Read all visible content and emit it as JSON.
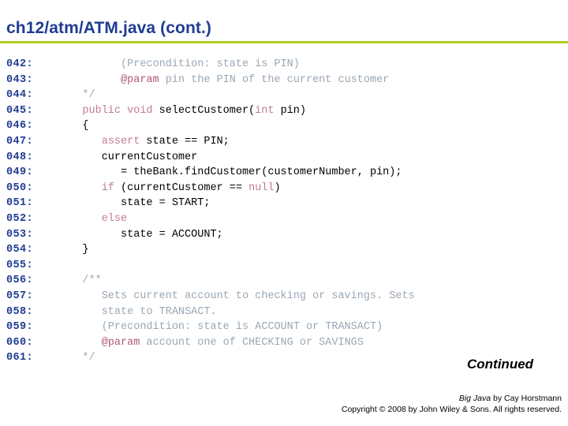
{
  "slide": {
    "title": "ch12/atm/ATM.java  (cont.)",
    "rule_color": "#b0ce22",
    "title_color": "#1f3c94"
  },
  "continued_label": "Continued",
  "footer": {
    "credit_book": "Big Java",
    "credit_rest": " by  Cay Horstmann",
    "copyright": "Copyright © 2008 by John Wiley  & Sons.  All rights reserved."
  },
  "colors": {
    "keyword": "#c07d92",
    "comment": "#9aa7b4",
    "javadoc_tag": "#b05878",
    "plain": "#000000",
    "lineno": "#1f3c94"
  },
  "code": {
    "lines": [
      {
        "no": "042:",
        "tokens": [
          {
            "t": "          (Precondition: state is PIN)",
            "c": "comment"
          }
        ]
      },
      {
        "no": "043:",
        "tokens": [
          {
            "t": "          ",
            "c": "plain"
          },
          {
            "t": "@param",
            "c": "tag"
          },
          {
            "t": " pin the PIN of the current customer",
            "c": "comment"
          }
        ]
      },
      {
        "no": "044:",
        "tokens": [
          {
            "t": "    */",
            "c": "comment"
          }
        ]
      },
      {
        "no": "045:",
        "tokens": [
          {
            "t": "    ",
            "c": "plain"
          },
          {
            "t": "public void",
            "c": "keyword"
          },
          {
            "t": " selectCustomer(",
            "c": "plain"
          },
          {
            "t": "int",
            "c": "keyword"
          },
          {
            "t": " pin)",
            "c": "plain"
          }
        ]
      },
      {
        "no": "046:",
        "tokens": [
          {
            "t": "    {",
            "c": "plain"
          }
        ]
      },
      {
        "no": "047:",
        "tokens": [
          {
            "t": "       ",
            "c": "plain"
          },
          {
            "t": "assert",
            "c": "keyword"
          },
          {
            "t": " state == PIN;",
            "c": "plain"
          }
        ]
      },
      {
        "no": "048:",
        "tokens": [
          {
            "t": "       currentCustomer",
            "c": "plain"
          }
        ]
      },
      {
        "no": "049:",
        "tokens": [
          {
            "t": "          = theBank.findCustomer(customerNumber, pin);",
            "c": "plain"
          }
        ]
      },
      {
        "no": "050:",
        "tokens": [
          {
            "t": "       ",
            "c": "plain"
          },
          {
            "t": "if",
            "c": "keyword"
          },
          {
            "t": " (currentCustomer == ",
            "c": "plain"
          },
          {
            "t": "null",
            "c": "keyword"
          },
          {
            "t": ")",
            "c": "plain"
          }
        ]
      },
      {
        "no": "051:",
        "tokens": [
          {
            "t": "          state = START;",
            "c": "plain"
          }
        ]
      },
      {
        "no": "052:",
        "tokens": [
          {
            "t": "       ",
            "c": "plain"
          },
          {
            "t": "else",
            "c": "keyword"
          }
        ]
      },
      {
        "no": "053:",
        "tokens": [
          {
            "t": "          state = ACCOUNT;",
            "c": "plain"
          }
        ]
      },
      {
        "no": "054:",
        "tokens": [
          {
            "t": "    }",
            "c": "plain"
          }
        ]
      },
      {
        "no": "055:",
        "tokens": [
          {
            "t": "",
            "c": "plain"
          }
        ]
      },
      {
        "no": "056:",
        "tokens": [
          {
            "t": "    /**",
            "c": "comment"
          }
        ]
      },
      {
        "no": "057:",
        "tokens": [
          {
            "t": "       Sets current account to checking or savings. Sets",
            "c": "comment"
          }
        ]
      },
      {
        "no": "058:",
        "tokens": [
          {
            "t": "       state to TRANSACT.",
            "c": "comment"
          }
        ]
      },
      {
        "no": "059:",
        "tokens": [
          {
            "t": "       (Precondition: state is ACCOUNT or TRANSACT)",
            "c": "comment"
          }
        ]
      },
      {
        "no": "060:",
        "tokens": [
          {
            "t": "       ",
            "c": "plain"
          },
          {
            "t": "@param",
            "c": "tag"
          },
          {
            "t": " account one of CHECKING or SAVINGS",
            "c": "comment"
          }
        ]
      },
      {
        "no": "061:",
        "tokens": [
          {
            "t": "    */",
            "c": "comment"
          }
        ]
      }
    ]
  }
}
